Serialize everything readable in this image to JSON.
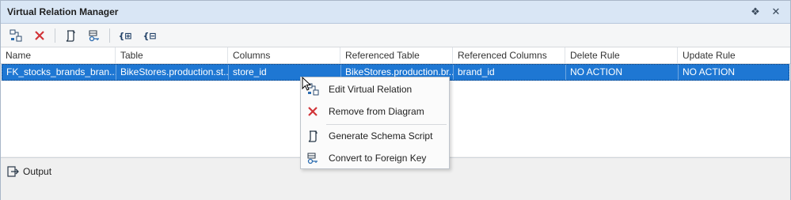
{
  "window": {
    "title": "Virtual Relation Manager"
  },
  "title_buttons": {
    "pin": "❖",
    "close": "✕"
  },
  "toolbar": {
    "buttons": [
      {
        "name": "edit-relation",
        "icon": "relation-icon"
      },
      {
        "name": "remove",
        "icon": "red-x-icon"
      },
      {
        "name": "generate-script",
        "icon": "script-icon"
      },
      {
        "name": "convert-fk",
        "icon": "foreign-key-icon"
      },
      {
        "name": "expand-all",
        "icon": "expand-braces-icon",
        "text": "{⊞"
      },
      {
        "name": "collapse-all",
        "icon": "collapse-braces-icon",
        "text": "{⊟"
      }
    ]
  },
  "grid": {
    "columns": [
      "Name",
      "Table",
      "Columns",
      "Referenced Table",
      "Referenced Columns",
      "Delete Rule",
      "Update Rule"
    ],
    "rows": [
      [
        "FK_stocks_brands_bran...",
        "BikeStores.production.st...",
        "store_id",
        "BikeStores.production.br...",
        "brand_id",
        "NO ACTION",
        "NO ACTION"
      ]
    ]
  },
  "bottom": {
    "output_tab": "Output"
  },
  "context_menu": {
    "items": [
      {
        "label": "Edit Virtual Relation",
        "icon": "relation-icon"
      },
      {
        "label": "Remove from Diagram",
        "icon": "red-x-icon"
      },
      {
        "label": "Generate Schema Script",
        "icon": "script-icon"
      },
      {
        "label": "Convert to Foreign Key",
        "icon": "foreign-key-icon"
      }
    ]
  },
  "colors": {
    "selection": "#1e77d3",
    "title_bg": "#d9e6f5",
    "remove_red": "#d13438"
  }
}
